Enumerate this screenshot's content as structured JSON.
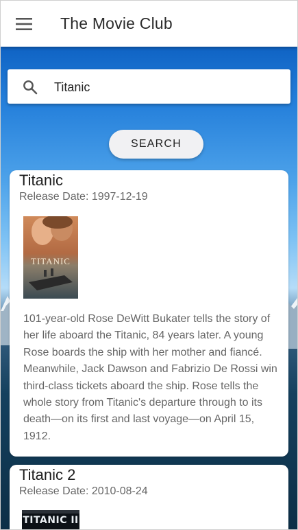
{
  "app": {
    "title": "The Movie Club",
    "menu_icon": "hamburger-menu-icon"
  },
  "search": {
    "value": "Titanic",
    "icon": "search-icon",
    "button_label": "SEARCH"
  },
  "movies": [
    {
      "title": "Titanic",
      "release_date_label": "Release Date: 1997-12-19",
      "poster_text": "TITANIC",
      "overview": "101-year-old Rose DeWitt Bukater tells the story of her life aboard the Titanic, 84 years later. A young Rose boards the ship with her mother and fiancé. Meanwhile, Jack Dawson and Fabrizio De Rossi win third-class tickets aboard the ship. Rose tells the whole story from Titanic's departure through to its death—on its first and last voyage—on April 15, 1912."
    },
    {
      "title": "Titanic 2",
      "release_date_label": "Release Date: 2010-08-24",
      "poster_text": "TITANIC II"
    }
  ]
}
